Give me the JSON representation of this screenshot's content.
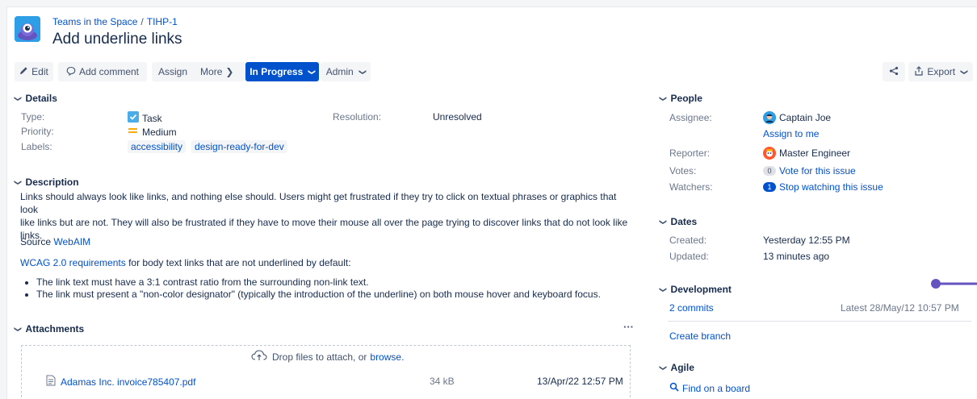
{
  "header": {
    "project": "Teams in the Space",
    "issue_key": "TIHP-1",
    "breadcrumb_sep": "/",
    "title": "Add underline links"
  },
  "toolbar": {
    "edit": "Edit",
    "add_comment": "Add comment",
    "assign": "Assign",
    "more": "More",
    "status": "In Progress",
    "admin": "Admin",
    "export": "Export"
  },
  "details": {
    "heading": "Details",
    "type_label": "Type:",
    "type_value": "Task",
    "priority_label": "Priority:",
    "priority_value": "Medium",
    "labels_label": "Labels:",
    "labels": [
      "accessibility",
      "design-ready-for-dev"
    ],
    "resolution_label": "Resolution:",
    "resolution_value": "Unresolved"
  },
  "description": {
    "heading": "Description",
    "p1_line1": "Links should always look like links, and nothing else should. Users might get frustrated if they try to click on textual phrases or graphics that look",
    "p1_line2": "like links but are not. They will also be frustrated if they have to move their mouse all over the page trying to discover links that do not look like",
    "p1_line3": "links.",
    "source_prefix": "Source",
    "source_link": "WebAIM",
    "wcag_link": "WCAG 2.0 requirements",
    "wcag_suffix": "for body text links that are not underlined by default:",
    "bullets": [
      "The link text must have a 3:1 contrast ratio from the surrounding non-link text.",
      "The link must present a \"non-color designator\" (typically the introduction of the underline) on both mouse hover and keyboard focus."
    ]
  },
  "attachments": {
    "heading": "Attachments",
    "more": "···",
    "drop_text": "Drop files to attach, or",
    "browse": "browse.",
    "file_name": "Adamas Inc. invoice785407.pdf",
    "file_size": "34 kB",
    "file_date": "13/Apr/22 12:57 PM"
  },
  "people": {
    "heading": "People",
    "assignee_label": "Assignee:",
    "assignee": "Captain Joe",
    "assign_to_me": "Assign to me",
    "reporter_label": "Reporter:",
    "reporter": "Master Engineer",
    "votes_label": "Votes:",
    "votes_count": "0",
    "vote_link": "Vote for this issue",
    "watchers_label": "Watchers:",
    "watchers_count": "1",
    "watch_link": "Stop watching this issue"
  },
  "dates": {
    "heading": "Dates",
    "created_label": "Created:",
    "created": "Yesterday 12:55 PM",
    "updated_label": "Updated:",
    "updated": "13 minutes ago"
  },
  "development": {
    "heading": "Development",
    "commits": "2 commits",
    "latest": "Latest 28/May/12 10:57 PM",
    "create_branch": "Create branch"
  },
  "agile": {
    "heading": "Agile",
    "find_board": "Find on a board"
  },
  "colors": {
    "primary": "#0052cc",
    "accent_purple": "#6554c0",
    "priority_yellow": "#ffab00"
  }
}
